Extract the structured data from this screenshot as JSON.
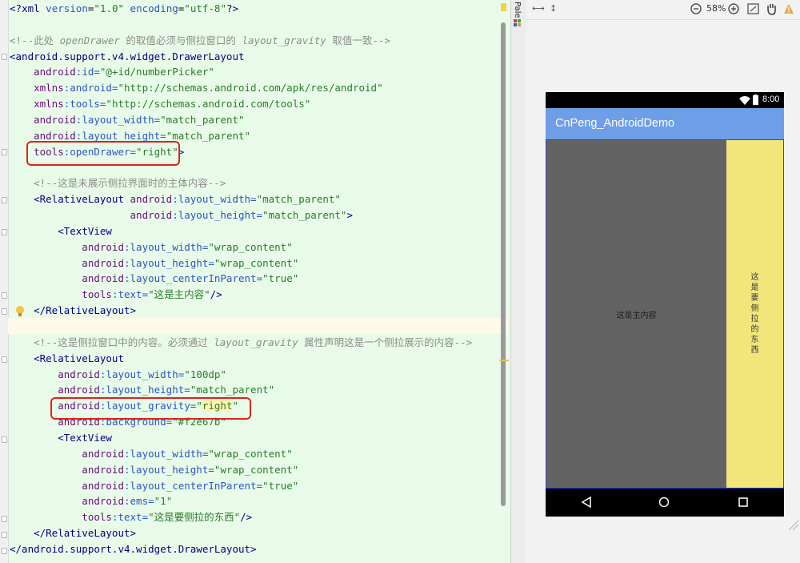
{
  "editor": {
    "lines": [
      {
        "segments": [
          {
            "text": "<?",
            "cls": "t"
          },
          {
            "text": "xml ",
            "cls": "t"
          },
          {
            "text": "version",
            "cls": "an"
          },
          {
            "text": "=",
            "cls": ""
          },
          {
            "text": "\"1.0\"",
            "cls": "v"
          },
          {
            "text": " encoding",
            "cls": "an"
          },
          {
            "text": "=",
            "cls": ""
          },
          {
            "text": "\"utf-8\"",
            "cls": "v"
          },
          {
            "text": "?>",
            "cls": "t"
          }
        ]
      },
      {
        "segments": []
      },
      {
        "segments": [
          {
            "text": "<!--此处 ",
            "cls": "ci"
          },
          {
            "text": "openDrawer",
            "cls": "c"
          },
          {
            "text": " 的取值必须与侧拉窗口的 ",
            "cls": "ci"
          },
          {
            "text": "layout_gravity",
            "cls": "c"
          },
          {
            "text": " 取值一致-->",
            "cls": "ci"
          }
        ]
      },
      {
        "segments": [
          {
            "text": "<android.support.v4.widget.DrawerLayout",
            "cls": "t"
          }
        ]
      },
      {
        "segments": [
          {
            "text": "    android",
            "cls": "ns"
          },
          {
            "text": ":id=",
            "cls": "an"
          },
          {
            "text": "\"@+id/numberPicker\"",
            "cls": "v"
          }
        ]
      },
      {
        "segments": [
          {
            "text": "    xmlns",
            "cls": "ns"
          },
          {
            "text": ":android=",
            "cls": "an"
          },
          {
            "text": "\"http://schemas.android.com/apk/res/android\"",
            "cls": "v"
          }
        ]
      },
      {
        "segments": [
          {
            "text": "    xmlns",
            "cls": "ns"
          },
          {
            "text": ":tools=",
            "cls": "an"
          },
          {
            "text": "\"http://schemas.android.com/tools\"",
            "cls": "v"
          }
        ]
      },
      {
        "segments": [
          {
            "text": "    android",
            "cls": "ns"
          },
          {
            "text": ":layout_width=",
            "cls": "an"
          },
          {
            "text": "\"match_parent\"",
            "cls": "v"
          }
        ]
      },
      {
        "segments": [
          {
            "text": "    android",
            "cls": "ns"
          },
          {
            "text": ":layout_height=",
            "cls": "an"
          },
          {
            "text": "\"match_parent\"",
            "cls": "v"
          }
        ]
      },
      {
        "segments": [
          {
            "text": "    tools",
            "cls": "ns"
          },
          {
            "text": ":openDrawer=",
            "cls": "an"
          },
          {
            "text": "\"right\"",
            "cls": "v"
          },
          {
            "text": ">",
            "cls": "t"
          }
        ]
      },
      {
        "segments": []
      },
      {
        "segments": [
          {
            "text": "    <!--这是未展示侧拉界面时的主体内容-->",
            "cls": "ci"
          }
        ]
      },
      {
        "segments": [
          {
            "text": "    <RelativeLayout ",
            "cls": "t"
          },
          {
            "text": "android",
            "cls": "ns"
          },
          {
            "text": ":layout_width=",
            "cls": "an"
          },
          {
            "text": "\"match_parent\"",
            "cls": "v"
          }
        ]
      },
      {
        "segments": [
          {
            "text": "                    android",
            "cls": "ns"
          },
          {
            "text": ":layout_height=",
            "cls": "an"
          },
          {
            "text": "\"match_parent\"",
            "cls": "v"
          },
          {
            "text": ">",
            "cls": "t"
          }
        ]
      },
      {
        "segments": [
          {
            "text": "        <TextView",
            "cls": "t"
          }
        ]
      },
      {
        "segments": [
          {
            "text": "            android",
            "cls": "ns"
          },
          {
            "text": ":layout_width=",
            "cls": "an"
          },
          {
            "text": "\"wrap_content\"",
            "cls": "v"
          }
        ]
      },
      {
        "segments": [
          {
            "text": "            android",
            "cls": "ns"
          },
          {
            "text": ":layout_height=",
            "cls": "an"
          },
          {
            "text": "\"wrap_content\"",
            "cls": "v"
          }
        ]
      },
      {
        "segments": [
          {
            "text": "            android",
            "cls": "ns"
          },
          {
            "text": ":layout_centerInParent=",
            "cls": "an"
          },
          {
            "text": "\"true\"",
            "cls": "v"
          }
        ]
      },
      {
        "segments": [
          {
            "text": "            tools",
            "cls": "ns"
          },
          {
            "text": ":text=",
            "cls": "an"
          },
          {
            "text": "\"这是主内容\"",
            "cls": "v"
          },
          {
            "text": "/>",
            "cls": "t"
          }
        ]
      },
      {
        "segments": [
          {
            "text": "    </RelativeLayout>",
            "cls": "t"
          }
        ]
      },
      {
        "segments": []
      },
      {
        "segments": [
          {
            "text": "    <!--这是侧拉窗口中的内容。必须通过 ",
            "cls": "ci"
          },
          {
            "text": "layout_gravity",
            "cls": "c"
          },
          {
            "text": " 属性声明这是一个侧拉展示的内容-->",
            "cls": "ci"
          }
        ]
      },
      {
        "segments": [
          {
            "text": "    <RelativeLayout",
            "cls": "t"
          }
        ]
      },
      {
        "segments": [
          {
            "text": "        android",
            "cls": "ns"
          },
          {
            "text": ":layout_width=",
            "cls": "an"
          },
          {
            "text": "\"100dp\"",
            "cls": "v"
          }
        ]
      },
      {
        "segments": [
          {
            "text": "        android",
            "cls": "ns"
          },
          {
            "text": ":layout_height=",
            "cls": "an"
          },
          {
            "text": "\"match_parent\"",
            "cls": "v"
          }
        ]
      },
      {
        "segments": [
          {
            "text": "        android",
            "cls": "ns"
          },
          {
            "text": ":layout_gravity=",
            "cls": "an"
          },
          {
            "text": "\"",
            "cls": "v"
          },
          {
            "text": "right",
            "cls": "v hl"
          },
          {
            "text": "\"",
            "cls": "v"
          }
        ]
      },
      {
        "segments": [
          {
            "text": "        android",
            "cls": "ns"
          },
          {
            "text": ":background=",
            "cls": "an"
          },
          {
            "text": "\"#f2e67b\"",
            "cls": "v"
          }
        ]
      },
      {
        "segments": [
          {
            "text": "        <TextView",
            "cls": "t"
          }
        ]
      },
      {
        "segments": [
          {
            "text": "            android",
            "cls": "ns"
          },
          {
            "text": ":layout_width=",
            "cls": "an"
          },
          {
            "text": "\"wrap_content\"",
            "cls": "v"
          }
        ]
      },
      {
        "segments": [
          {
            "text": "            android",
            "cls": "ns"
          },
          {
            "text": ":layout_height=",
            "cls": "an"
          },
          {
            "text": "\"wrap_content\"",
            "cls": "v"
          }
        ]
      },
      {
        "segments": [
          {
            "text": "            android",
            "cls": "ns"
          },
          {
            "text": ":layout_centerInParent=",
            "cls": "an"
          },
          {
            "text": "\"true\"",
            "cls": "v"
          }
        ]
      },
      {
        "segments": [
          {
            "text": "            android",
            "cls": "ns"
          },
          {
            "text": ":ems=",
            "cls": "an"
          },
          {
            "text": "\"1\"",
            "cls": "v"
          }
        ]
      },
      {
        "segments": [
          {
            "text": "            tools",
            "cls": "ns"
          },
          {
            "text": ":text=",
            "cls": "an"
          },
          {
            "text": "\"这是要侧拉的东西\"",
            "cls": "v"
          },
          {
            "text": "/>",
            "cls": "t"
          }
        ]
      },
      {
        "segments": [
          {
            "text": "    </RelativeLayout>",
            "cls": "t"
          }
        ]
      },
      {
        "segments": [
          {
            "text": "</android.support.v4.widget.DrawerLayout>",
            "cls": "t"
          }
        ]
      }
    ]
  },
  "palette": {
    "label": "Pale"
  },
  "toolbar": {
    "zoom": "58%"
  },
  "preview": {
    "status_time": "8:00",
    "app_title": "CnPeng_AndroidDemo",
    "main_text": "这是主内容",
    "drawer_text": "这是要侧拉的东西",
    "drawer_color": "#f2e67b",
    "appbar_color": "#6e9ee8",
    "main_color": "#636363"
  }
}
